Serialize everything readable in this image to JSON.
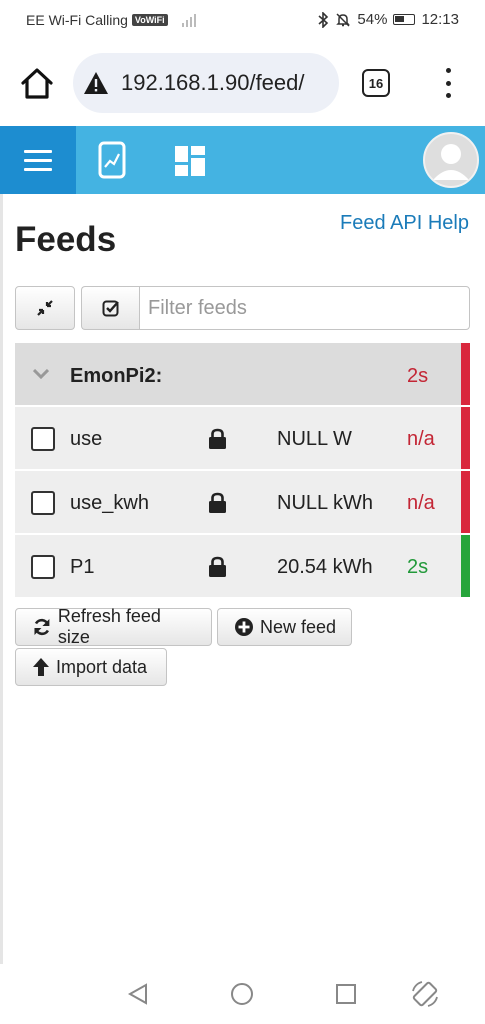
{
  "status_bar": {
    "carrier": "EE Wi-Fi Calling",
    "vowifi": "VoWiFi",
    "battery": "54%",
    "time": "12:13"
  },
  "browser": {
    "url": "192.168.1.90/feed/",
    "tab_count": "16"
  },
  "page": {
    "title": "Feeds",
    "api_help": "Feed API Help",
    "filter_placeholder": "Filter feeds"
  },
  "feeds": {
    "group": {
      "name": "EmonPi2:",
      "updated": "2s",
      "status": "stale"
    },
    "rows": [
      {
        "name": "use",
        "value": "NULL W",
        "updated": "n/a",
        "status": "stale"
      },
      {
        "name": "use_kwh",
        "value": "NULL kWh",
        "updated": "n/a",
        "status": "stale"
      },
      {
        "name": "P1",
        "value": "20.54 kWh",
        "updated": "2s",
        "status": "active"
      }
    ]
  },
  "actions": {
    "refresh": "Refresh feed size",
    "new_feed": "New feed",
    "import": "Import data"
  },
  "colors": {
    "nav_bg": "#44b3e2",
    "nav_active": "#1d8dd0",
    "link": "#1a7bb9",
    "stale": "#d9273d",
    "active": "#26a53b"
  }
}
